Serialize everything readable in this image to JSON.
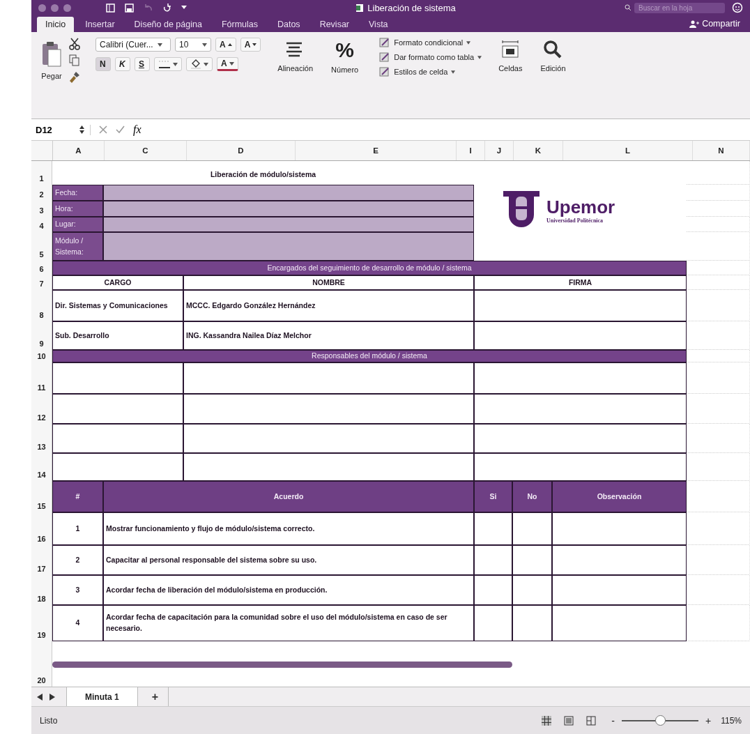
{
  "window": {
    "title": "Liberación de sistema",
    "search": {
      "placeholder": "Buscar en la hoja"
    }
  },
  "tabs": [
    {
      "label": "Inicio",
      "selected": true
    },
    {
      "label": "Insertar",
      "selected": false
    },
    {
      "label": "Diseño de página",
      "selected": false
    },
    {
      "label": "Fórmulas",
      "selected": false
    },
    {
      "label": "Datos",
      "selected": false
    },
    {
      "label": "Revisar",
      "selected": false
    },
    {
      "label": "Vista",
      "selected": false
    }
  ],
  "share": "Compartir",
  "ribbon": {
    "paste": "Pegar",
    "font": "Calibri (Cuer...",
    "size": "10",
    "grow": "A",
    "shrink": "A",
    "bold": "N",
    "italic": "K",
    "underline": "S",
    "font_color": "A",
    "alignment": "Alineación",
    "number_glyph": "%",
    "number": "Número",
    "styles": [
      "Formato condicional",
      "Dar formato como tabla",
      "Estilos de celda"
    ],
    "cells": "Celdas",
    "editing": "Edición"
  },
  "formula_bar": {
    "cell_ref": "D12",
    "fx": "fx"
  },
  "columns": [
    "A",
    "C",
    "D",
    "E",
    "I",
    "J",
    "K",
    "L",
    "N"
  ],
  "row_numbers": [
    "1",
    "2",
    "3",
    "4",
    "5",
    "6",
    "7",
    "8",
    "9",
    "10",
    "11",
    "12",
    "13",
    "14",
    "15",
    "16",
    "17",
    "18",
    "19",
    "20"
  ],
  "sheet": {
    "title": "Liberación de módulo/sistema",
    "fields": [
      {
        "label": "Fecha:"
      },
      {
        "label": "Hora:"
      },
      {
        "label": "Lugar:"
      },
      {
        "label": "Módulo / Sistema:"
      }
    ],
    "logo": {
      "name": "Upemor",
      "subtitle": "Universidad Politécnica"
    },
    "section_1": "Encargados del seguimiento de desarrollo de módulo / sistema",
    "people_headers": [
      "CARGO",
      "NOMBRE",
      "FIRMA"
    ],
    "people": [
      {
        "cargo": "Dir. Sistemas y Comunicaciones",
        "nombre": "MCCC. Edgardo González Hernández"
      },
      {
        "cargo": "Sub. Desarrollo",
        "nombre": "ING. Kassandra Nailea Díaz Melchor"
      }
    ],
    "section_2": "Responsables del módulo / sistema",
    "agreement_headers": [
      "#",
      "Acuerdo",
      "Si",
      "No",
      "Observación"
    ],
    "agreements": [
      {
        "number": "1",
        "text": "Mostrar funcionamiento y flujo de módulo/sistema correcto."
      },
      {
        "number": "2",
        "text": "Capacitar al personal responsable del sistema sobre su uso."
      },
      {
        "number": "3",
        "text": "Acordar fecha de liberación del módulo/sistema en producción."
      },
      {
        "number": "4",
        "text": "Acordar fecha de capacitación para la comunidad sobre el uso del módulo/sistema en caso de ser necesario."
      }
    ]
  },
  "sheet_tabs": [
    {
      "label": "Minuta 1",
      "selected": true
    }
  ],
  "add_sheet": "+",
  "status": {
    "text": "Listo",
    "zoom_out": "-",
    "zoom_in": "+",
    "zoom_slider": {
      "level": 0.5
    },
    "zoom": "115%"
  }
}
